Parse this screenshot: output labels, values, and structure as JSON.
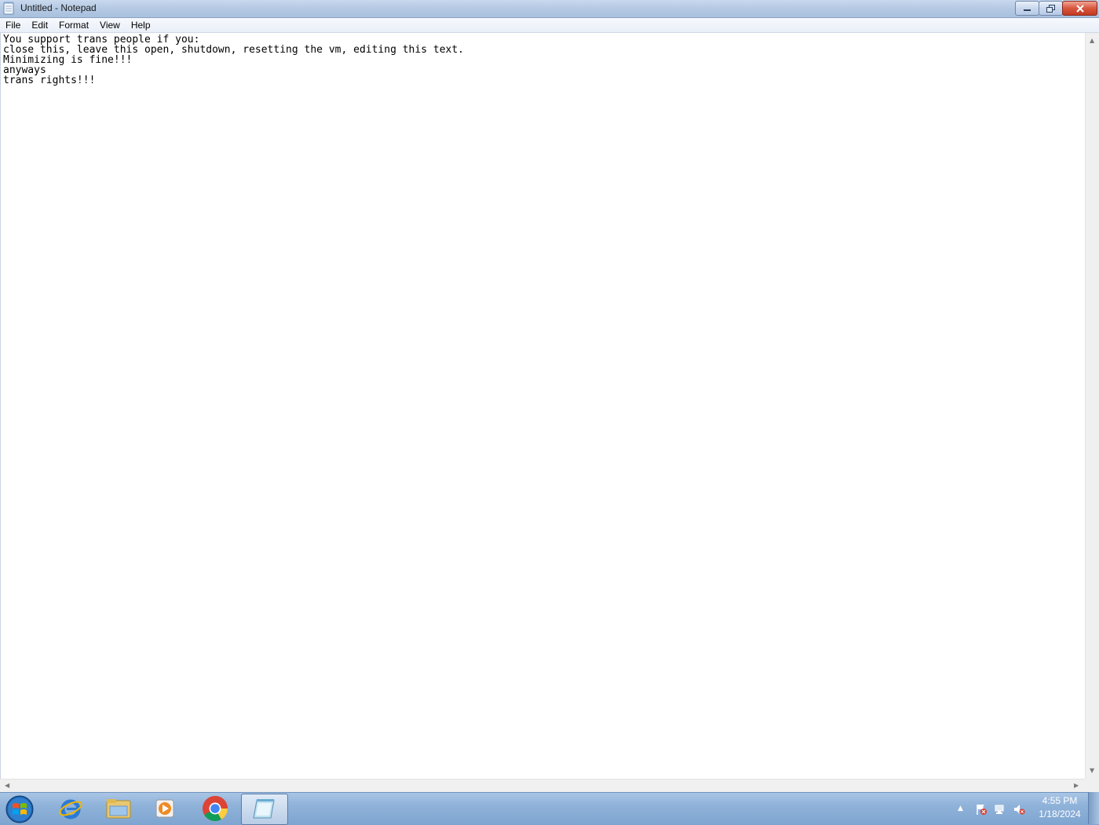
{
  "window": {
    "title": "Untitled - Notepad",
    "icon": "notepad-icon"
  },
  "menu": [
    "File",
    "Edit",
    "Format",
    "View",
    "Help"
  ],
  "editor": {
    "text": "You support trans people if you:\nclose this, leave this open, shutdown, resetting the vm, editing this text.\nMinimizing is fine!!!\nanyways\ntrans rights!!!"
  },
  "taskbar": {
    "apps": [
      "start-orb",
      "internet-explorer-icon",
      "file-explorer-icon",
      "media-player-icon",
      "chrome-icon",
      "notepad-icon"
    ],
    "active_app": "notepad-icon"
  },
  "tray": {
    "icons": [
      "show-hidden-icons-arrow",
      "action-center-flag-icon",
      "network-icon",
      "volume-muted-icon"
    ],
    "time": "4:55 PM",
    "date": "1/18/2024"
  }
}
